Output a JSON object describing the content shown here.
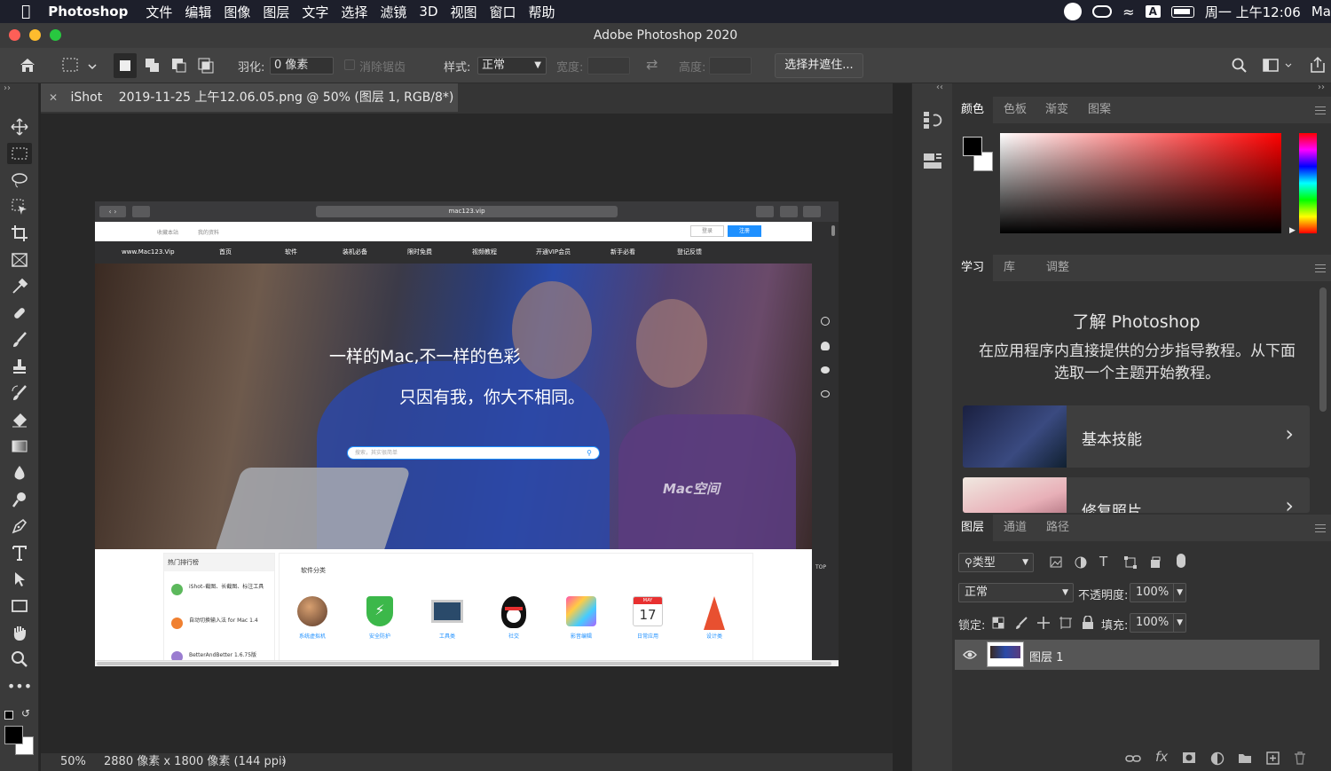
{
  "menubar": {
    "apple": "",
    "app": "Photoshop",
    "items": [
      "文件",
      "编辑",
      "图像",
      "图层",
      "文字",
      "选择",
      "滤镜",
      "3D",
      "视图",
      "窗口",
      "帮助"
    ],
    "clock": "周一 上午12:06",
    "right_tail": "Ma",
    "input_badge": "A"
  },
  "window": {
    "title": "Adobe Photoshop 2020"
  },
  "options": {
    "feather_label": "羽化:",
    "feather_value": "0 像素",
    "antialias_label": "消除锯齿",
    "style_label": "样式:",
    "style_value": "正常",
    "width_label": "宽度:",
    "height_label": "高度:",
    "select_mask_button": "选择并遮住..."
  },
  "document": {
    "tab_app": "iShot",
    "tab_title": "2019-11-25 上午12.06.05.png @ 50% (图层 1, RGB/8*)",
    "zoom": "50%",
    "info": "2880 像素 x 1800 像素 (144 ppi)"
  },
  "site": {
    "url": "mac123.vip",
    "top_links": [
      "收藏本站",
      "我的资料"
    ],
    "login": "登录",
    "register": "注册",
    "logo": "www.Mac123.Vip",
    "nav": [
      "首页",
      "软件",
      "装机必备",
      "限时免费",
      "视频教程",
      "开通VIP会员",
      "新手必看",
      "登记反馈"
    ],
    "hero_line1": "一样的Mac,不一样的色彩",
    "hero_line2": "只因有我，你大不相同。",
    "search_placeholder": "搜索，其实很简单",
    "watermark": "Mac空间",
    "hot_title": "热门排行榜",
    "hot_items": [
      "iShot–截图、长截图、标注工具",
      "自动切换输入法 for Mac 1.4",
      "BetterAndBetter 1.6.75版"
    ],
    "category_title": "软件分类",
    "categories": [
      "系统虚拟机",
      "安全防护",
      "工具类",
      "社交",
      "影音编辑",
      "日常应用",
      "设计类"
    ],
    "calendar_day": "17",
    "calendar_month": "MAY",
    "top_label": "TOP"
  },
  "color_panel": {
    "tabs": [
      "颜色",
      "色板",
      "渐变",
      "图案"
    ],
    "fg_color": "#000000",
    "bg_color": "#ffffff"
  },
  "learn_panel": {
    "tabs": [
      "学习",
      "库",
      "调整"
    ],
    "heading": "了解 Photoshop",
    "description": "在应用程序内直接提供的分步指导教程。从下面选取一个主题开始教程。",
    "cards": [
      "基本技能",
      "修复照片"
    ]
  },
  "layers_panel": {
    "tabs": [
      "图层",
      "通道",
      "路径"
    ],
    "filter_label": "类型",
    "blend_mode": "正常",
    "opacity_label": "不透明度:",
    "opacity_value": "100%",
    "lock_label": "锁定:",
    "fill_label": "填充:",
    "fill_value": "100%",
    "layer_name": "图层 1"
  },
  "colors": {
    "accent_blue": "#1e90ff",
    "menubar_bg": "#1d1f2b",
    "panel_bg": "#323232",
    "shirt_blue": "#2a4aa8"
  }
}
